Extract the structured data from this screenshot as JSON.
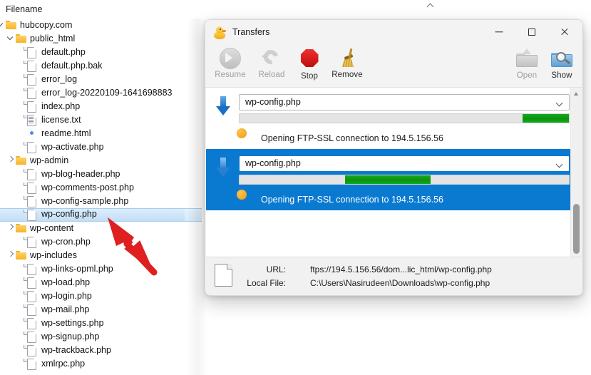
{
  "browser": {
    "column_header": "Filename",
    "tree": [
      {
        "name": "hubcopy.com",
        "indent": 0,
        "icon": "folder-icon",
        "twisty": "down",
        "selected": false
      },
      {
        "name": "public_html",
        "indent": 1,
        "icon": "folder-icon",
        "twisty": "down",
        "selected": false
      },
      {
        "name": "default.php",
        "indent": 2,
        "icon": "file-icon",
        "twisty": "none",
        "selected": false
      },
      {
        "name": "default.php.bak",
        "indent": 2,
        "icon": "file-icon",
        "twisty": "none",
        "selected": false
      },
      {
        "name": "error_log",
        "indent": 2,
        "icon": "file-icon",
        "twisty": "none",
        "selected": false
      },
      {
        "name": "error_log-20220109-1641698883",
        "indent": 2,
        "icon": "file-icon",
        "twisty": "none",
        "selected": false
      },
      {
        "name": "index.php",
        "indent": 2,
        "icon": "file-icon",
        "twisty": "none",
        "selected": false
      },
      {
        "name": "license.txt",
        "indent": 2,
        "icon": "text-file-icon",
        "twisty": "none",
        "selected": false
      },
      {
        "name": "readme.html",
        "indent": 2,
        "icon": "chrome-icon",
        "twisty": "none",
        "selected": false
      },
      {
        "name": "wp-activate.php",
        "indent": 2,
        "icon": "file-icon",
        "twisty": "none",
        "selected": false
      },
      {
        "name": "wp-admin",
        "indent": 1,
        "icon": "folder-icon",
        "twisty": "right",
        "selected": false
      },
      {
        "name": "wp-blog-header.php",
        "indent": 2,
        "icon": "file-icon",
        "twisty": "none",
        "selected": false
      },
      {
        "name": "wp-comments-post.php",
        "indent": 2,
        "icon": "file-icon",
        "twisty": "none",
        "selected": false
      },
      {
        "name": "wp-config-sample.php",
        "indent": 2,
        "icon": "file-icon",
        "twisty": "none",
        "selected": false
      },
      {
        "name": "wp-config.php",
        "indent": 2,
        "icon": "file-icon",
        "twisty": "none",
        "selected": true
      },
      {
        "name": "wp-content",
        "indent": 1,
        "icon": "folder-icon",
        "twisty": "right",
        "selected": false
      },
      {
        "name": "wp-cron.php",
        "indent": 2,
        "icon": "file-icon",
        "twisty": "none",
        "selected": false
      },
      {
        "name": "wp-includes",
        "indent": 1,
        "icon": "folder-icon",
        "twisty": "right",
        "selected": false
      },
      {
        "name": "wp-links-opml.php",
        "indent": 2,
        "icon": "file-icon",
        "twisty": "none",
        "selected": false
      },
      {
        "name": "wp-load.php",
        "indent": 2,
        "icon": "file-icon",
        "twisty": "none",
        "selected": false
      },
      {
        "name": "wp-login.php",
        "indent": 2,
        "icon": "file-icon",
        "twisty": "none",
        "selected": false
      },
      {
        "name": "wp-mail.php",
        "indent": 2,
        "icon": "file-icon",
        "twisty": "none",
        "selected": false
      },
      {
        "name": "wp-settings.php",
        "indent": 2,
        "icon": "file-icon",
        "twisty": "none",
        "selected": false
      },
      {
        "name": "wp-signup.php",
        "indent": 2,
        "icon": "file-icon",
        "twisty": "none",
        "selected": false
      },
      {
        "name": "wp-trackback.php",
        "indent": 2,
        "icon": "file-icon",
        "twisty": "none",
        "selected": false
      },
      {
        "name": "xmlrpc.php",
        "indent": 2,
        "icon": "file-icon",
        "twisty": "none",
        "selected": false
      }
    ]
  },
  "dialog": {
    "title": "Transfers",
    "app_icon": "duck-icon",
    "window_controls": {
      "minimize": "minimize-icon",
      "maximize": "maximize-icon",
      "close": "close-icon"
    },
    "toolbar": {
      "left": [
        {
          "label": "Resume",
          "icon": "resume-icon",
          "enabled": false
        },
        {
          "label": "Reload",
          "icon": "reload-icon",
          "enabled": false
        },
        {
          "label": "Stop",
          "icon": "stop-icon",
          "enabled": true
        },
        {
          "label": "Remove",
          "icon": "broom-icon",
          "enabled": true
        }
      ],
      "right": [
        {
          "label": "Open",
          "icon": "open-folder-icon",
          "enabled": false
        },
        {
          "label": "Show",
          "icon": "show-folder-icon",
          "enabled": true
        }
      ]
    },
    "transfers": [
      {
        "filename": "wp-config.php",
        "direction_icon": "download-arrow-icon",
        "status_icon": "orange-dot-icon",
        "message": "Opening FTP-SSL connection to 194.5.156.56",
        "progress_start_pct": 86,
        "progress_end_pct": 100,
        "selected": false
      },
      {
        "filename": "wp-config.php",
        "direction_icon": "download-arrow-icon",
        "status_icon": "orange-dot-icon",
        "message": "Opening FTP-SSL connection to 194.5.156.56",
        "progress_start_pct": 32,
        "progress_end_pct": 58,
        "selected": true
      }
    ],
    "status": {
      "url_label": "URL:",
      "url_value": "ftps://194.5.156.56/dom...lic_html/wp-config.php",
      "local_label": "Local File:",
      "local_value": "C:\\Users\\Nasirudeen\\Downloads\\wp-config.php",
      "file_icon": "document-icon",
      "buttons": [
        {
          "icon": "bandwidth-icon",
          "dropdown": "chevron-down-icon"
        },
        {
          "icon": "connections-icon",
          "dropdown": "chevron-down-icon"
        }
      ]
    },
    "scrollbar": {
      "up": "scroll-up-arrow-icon",
      "down": "scroll-down-arrow-icon",
      "thumb": "scroll-thumb"
    }
  },
  "annotation": {
    "arrow_color": "#e02020",
    "shape": "red-arrow-pointing-to-wp-config"
  },
  "colors": {
    "selection_blue": "#0a7ad1",
    "progress_green": "#0a9410",
    "tree_selection": "#cfe6fa",
    "accent_orange": "#ef9b10"
  }
}
